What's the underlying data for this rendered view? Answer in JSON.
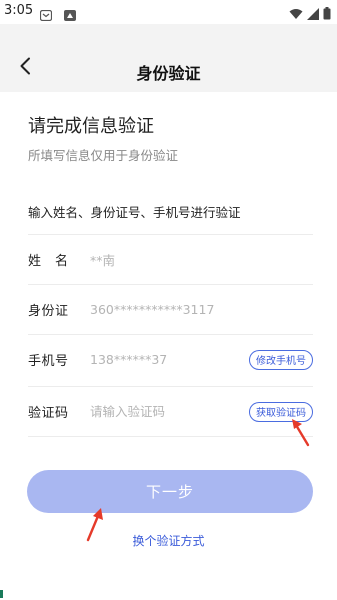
{
  "status_bar": {
    "time": "3:05",
    "icons": [
      "notification-app-icon",
      "android-app-icon",
      "wifi-icon",
      "signal-icon",
      "battery-icon"
    ]
  },
  "header": {
    "title": "身份验证",
    "back_icon": "chevron-left-icon"
  },
  "main": {
    "heading": "请完成信息验证",
    "subheading": "所填写信息仅用于身份验证",
    "instruction": "输入姓名、身份证号、手机号进行验证"
  },
  "form": {
    "name": {
      "label": "姓　名",
      "value": "**南"
    },
    "id_card": {
      "label": "身份证",
      "value": "360***********3117"
    },
    "phone": {
      "label": "手机号",
      "value": "138******37",
      "action_label": "修改手机号"
    },
    "code": {
      "label": "验证码",
      "placeholder": "请输入验证码",
      "action_label": "获取验证码"
    }
  },
  "actions": {
    "submit_label": "下一步",
    "switch_method_label": "换个验证方式"
  },
  "colors": {
    "accent": "#3a5bd9",
    "submit_disabled": "#a9b7f1",
    "header_bg": "#f3f3f3",
    "annotation_arrow": "#e53a2a"
  }
}
